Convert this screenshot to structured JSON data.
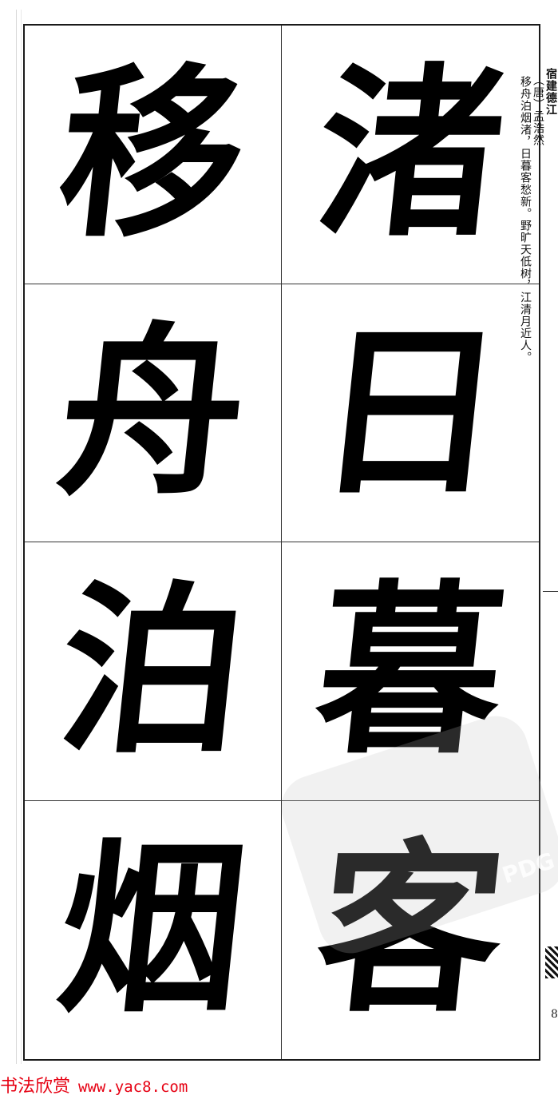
{
  "calligraphy": {
    "columns": [
      [
        "移",
        "舟",
        "泊",
        "烟"
      ],
      [
        "渚",
        "日",
        "暮",
        "客"
      ]
    ]
  },
  "side_text": {
    "title": "宿建德江",
    "author": "（唐）孟浩然",
    "poem": "移舟泊烟渚，日暮客愁新。野旷天低树，江清月近人。"
  },
  "page_number": "8",
  "watermark": "PDG",
  "footer": {
    "site_name": "书法欣赏",
    "url": "www.yac8.com",
    "color": "#e60012"
  }
}
